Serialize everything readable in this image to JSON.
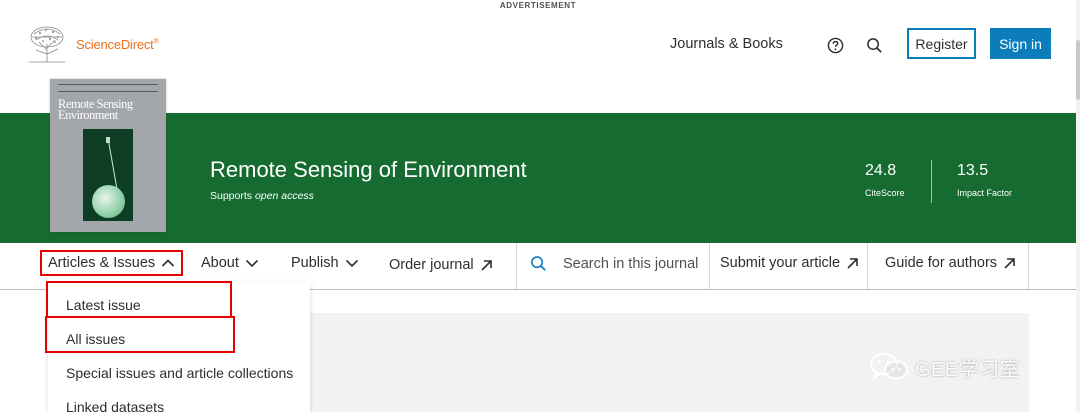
{
  "ad_label": "ADVERTISEMENT",
  "header": {
    "logo_text": "ScienceDirect",
    "logo_registered": "®",
    "journals_books": "Journals & Books",
    "register": "Register",
    "sign_in": "Sign in"
  },
  "journal": {
    "cover_title_line1": "Remote Sensing",
    "cover_title_line2": "Environment",
    "title": "Remote Sensing of Environment",
    "supports": "Supports",
    "open_access": "open access",
    "metrics": [
      {
        "value": "24.8",
        "label": "CiteScore"
      },
      {
        "value": "13.5",
        "label": "Impact Factor"
      }
    ]
  },
  "nav": {
    "articles_issues": "Articles & Issues",
    "about": "About",
    "publish": "Publish",
    "order_journal": "Order journal",
    "search_journal": "Search in this journal",
    "submit_article": "Submit your article",
    "guide_authors": "Guide for authors"
  },
  "dropdown": {
    "items": [
      "Latest issue",
      "All issues",
      "Special issues and article collections",
      "Linked datasets"
    ]
  },
  "watermark": "GEE学习室",
  "colors": {
    "brand_orange": "#e9711c",
    "banner_green": "#166c30",
    "primary_blue": "#0c7dbb",
    "highlight_red": "#e60000"
  }
}
